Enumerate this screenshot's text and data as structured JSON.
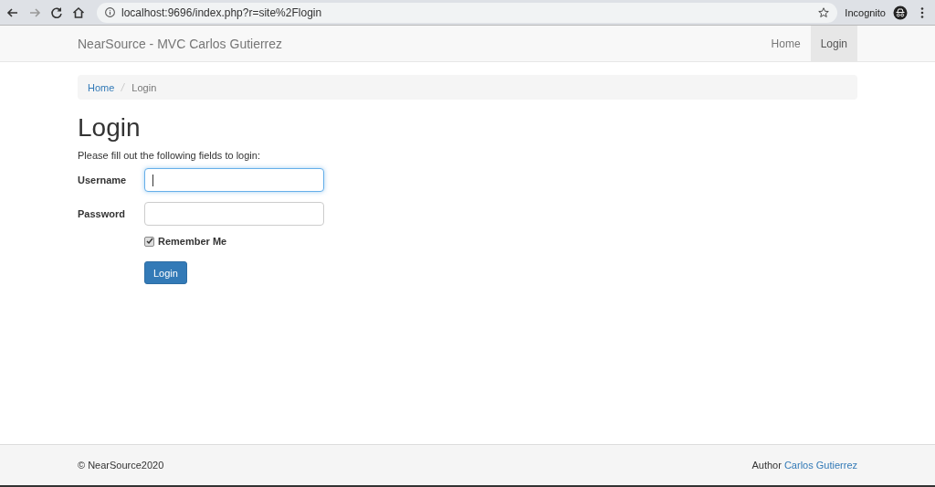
{
  "browser": {
    "url": "localhost:9696/index.php?r=site%2Flogin",
    "profile": "Incognito"
  },
  "navbar": {
    "brand": "NearSource - MVC Carlos Gutierrez",
    "items": [
      {
        "label": "Home",
        "selected": false
      },
      {
        "label": "Login",
        "selected": true
      }
    ]
  },
  "breadcrumb": [
    {
      "label": "Home",
      "kind": "link"
    },
    {
      "label": "Login",
      "kind": "current"
    }
  ],
  "heading": "Login",
  "intro": "Please fill out the following fields to login:",
  "fields": [
    {
      "label": "Username",
      "focused": true
    },
    {
      "label": "Password",
      "focused": false
    }
  ],
  "remember": {
    "label": "Remember Me",
    "checked": true
  },
  "submit": "Login",
  "footer": {
    "copyright": "© NearSource2020",
    "author_prefix": "Author",
    "author_link": "Carlos Gutierrez"
  }
}
